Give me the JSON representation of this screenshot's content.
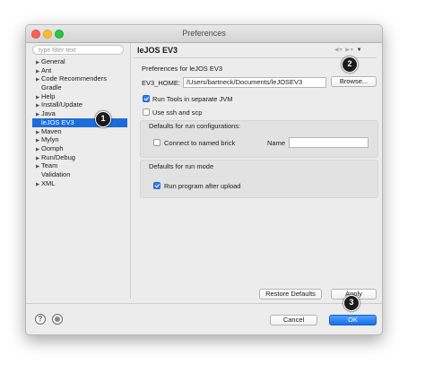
{
  "window": {
    "title": "Preferences"
  },
  "filter": {
    "placeholder": "type filter text"
  },
  "tree": [
    {
      "label": "General",
      "arrow": true
    },
    {
      "label": "Ant",
      "arrow": true
    },
    {
      "label": "Code Recommenders",
      "arrow": true
    },
    {
      "label": "Gradle",
      "arrow": false
    },
    {
      "label": "Help",
      "arrow": true
    },
    {
      "label": "Install/Update",
      "arrow": true
    },
    {
      "label": "Java",
      "arrow": true
    },
    {
      "label": "leJOS EV3",
      "arrow": false,
      "selected": true
    },
    {
      "label": "Maven",
      "arrow": true
    },
    {
      "label": "Mylyn",
      "arrow": true
    },
    {
      "label": "Oomph",
      "arrow": true
    },
    {
      "label": "Run/Debug",
      "arrow": true
    },
    {
      "label": "Team",
      "arrow": true
    },
    {
      "label": "Validation",
      "arrow": false
    },
    {
      "label": "XML",
      "arrow": true
    }
  ],
  "page": {
    "title": "leJOS EV3",
    "subtitle": "Preferences for leJOS EV3",
    "ev3home_label": "EV3_HOME:",
    "ev3home_value": "/Users/bartneck/Documents/leJOSEV3",
    "browse_label": "Browse...",
    "run_tools_label": "Run Tools in separate JVM",
    "run_tools_checked": true,
    "ssh_label": "Use ssh and scp",
    "ssh_checked": false,
    "run_config_group": "Defaults for run configurations:",
    "connect_label": "Connect to named brick",
    "connect_checked": false,
    "name_label": "Name",
    "name_value": "",
    "run_mode_group": "Defaults for run mode",
    "run_after_upload_label": "Run program after upload",
    "run_after_upload_checked": true,
    "restore_label": "Restore Defaults",
    "apply_label": "Apply"
  },
  "footer": {
    "help_icon": "?",
    "cancel_label": "Cancel",
    "ok_label": "OK"
  },
  "badges": [
    "1",
    "2",
    "3"
  ],
  "colors": {
    "selection": "#1c6cd9",
    "default_button": "#1a6fe8",
    "badge": "#1b1b1b"
  }
}
